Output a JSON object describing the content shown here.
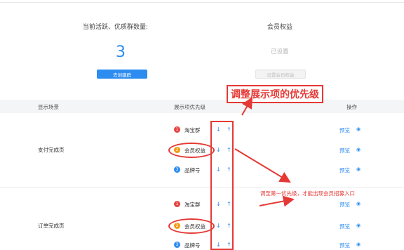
{
  "stats": {
    "groups_title": "当前活跃、优质群数量:",
    "groups_count": "3",
    "create_btn": "去创建群",
    "benefit_title": "会员权益",
    "benefit_status": "已设置",
    "setup_btn": "设置会员权益"
  },
  "table": {
    "headers": [
      "显示场景",
      "展示项优先级",
      "操作"
    ],
    "sections": [
      {
        "scene": "支付完成页",
        "items": [
          {
            "num": "1",
            "label": "淘宝群",
            "color": "#e64340"
          },
          {
            "num": "2",
            "label": "会员权益",
            "color": "#f39c12"
          },
          {
            "num": "3",
            "label": "品牌号",
            "color": "#2d8cf0"
          }
        ]
      },
      {
        "scene": "订单完成页",
        "items": [
          {
            "num": "1",
            "label": "淘宝群",
            "color": "#e64340"
          },
          {
            "num": "2",
            "label": "会员权益",
            "color": "#f39c12"
          },
          {
            "num": "3",
            "label": "品牌号",
            "color": "#2d8cf0"
          }
        ]
      }
    ],
    "preview_label": "预览",
    "arrow_down": "↓",
    "arrow_up": "↑"
  },
  "annotations": {
    "callout_title": "调整展示项的优先级",
    "callout_note": "调至第一优先级，才能出现会员招募入口"
  },
  "colors": {
    "accent": "#2d8cf0",
    "annotation": "#e53935"
  }
}
